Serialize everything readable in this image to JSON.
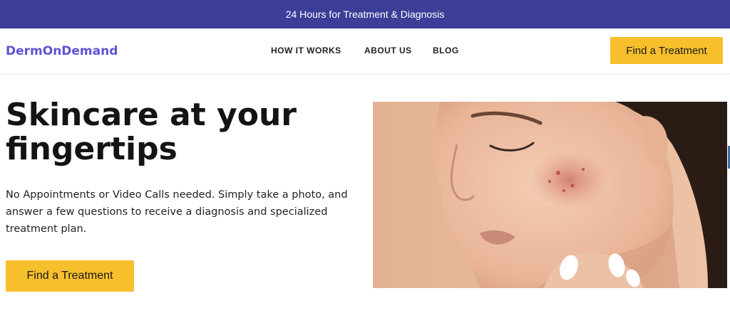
{
  "announcement": {
    "text": "24 Hours for Treatment & Diagnosis"
  },
  "header": {
    "logo": "DermOnDemand",
    "nav": [
      "HOW IT WORKS",
      "ABOUT US",
      "BLOG"
    ],
    "cta_label": "Find a Treatment"
  },
  "hero": {
    "title_lines": [
      "Skincare at your",
      "fingertips"
    ],
    "description": "No Appointments or Video Calls needed. Simply take a photo, and answer a few questions to receive a diagnosis and specialized treatment plan.",
    "cta_label": "Find a Treatment",
    "image_subject": "close-up of woman's face with eyes closed, acne on cheek, fingers touching chin"
  },
  "colors": {
    "announcement_bg": "#3d3e98",
    "brand": "#5b54d6",
    "cta": "#f8bf2d",
    "text": "#141414"
  }
}
